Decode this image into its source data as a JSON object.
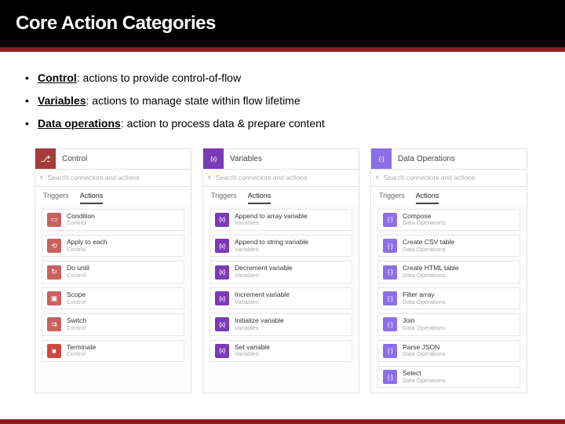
{
  "slide": {
    "title": "Core Action Categories"
  },
  "bullets": [
    {
      "term": "Control",
      "desc": ": actions to provide control-of-flow"
    },
    {
      "term": "Variables",
      "desc": ": actions to manage state within flow lifetime"
    },
    {
      "term": "Data operations",
      "desc": ": action to process data & prepare content"
    }
  ],
  "common": {
    "search_placeholder": "Search connectors and actions",
    "tab_triggers": "Triggers",
    "tab_actions": "Actions"
  },
  "panels": {
    "control": {
      "header": "Control",
      "items": [
        {
          "title": "Condition",
          "sub": "Control",
          "color": "c-control-light",
          "glyph": "glyph-box"
        },
        {
          "title": "Apply to each",
          "sub": "Control",
          "color": "c-control-light",
          "glyph": "glyph-each"
        },
        {
          "title": "Do until",
          "sub": "Control",
          "color": "c-control-light",
          "glyph": "glyph-until"
        },
        {
          "title": "Scope",
          "sub": "Control",
          "color": "c-control-light",
          "glyph": "glyph-scope"
        },
        {
          "title": "Switch",
          "sub": "Control",
          "color": "c-control-light",
          "glyph": "glyph-switch"
        },
        {
          "title": "Terminate",
          "sub": "Control",
          "color": "c-term",
          "glyph": "glyph-stop"
        }
      ]
    },
    "variables": {
      "header": "Variables",
      "items": [
        {
          "title": "Append to array variable",
          "sub": "Variables"
        },
        {
          "title": "Append to string variable",
          "sub": "Variables"
        },
        {
          "title": "Decrement variable",
          "sub": "Variables"
        },
        {
          "title": "Increment variable",
          "sub": "Variables"
        },
        {
          "title": "Initialize variable",
          "sub": "Variables"
        },
        {
          "title": "Set variable",
          "sub": "Variables"
        }
      ]
    },
    "data": {
      "header": "Data Operations",
      "items": [
        {
          "title": "Compose",
          "sub": "Data Operations"
        },
        {
          "title": "Create CSV table",
          "sub": "Data Operations"
        },
        {
          "title": "Create HTML table",
          "sub": "Data Operations"
        },
        {
          "title": "Filter array",
          "sub": "Data Operations"
        },
        {
          "title": "Join",
          "sub": "Data Operations"
        },
        {
          "title": "Parse JSON",
          "sub": "Data Operations"
        },
        {
          "title": "Select",
          "sub": "Data Operations"
        }
      ]
    }
  }
}
